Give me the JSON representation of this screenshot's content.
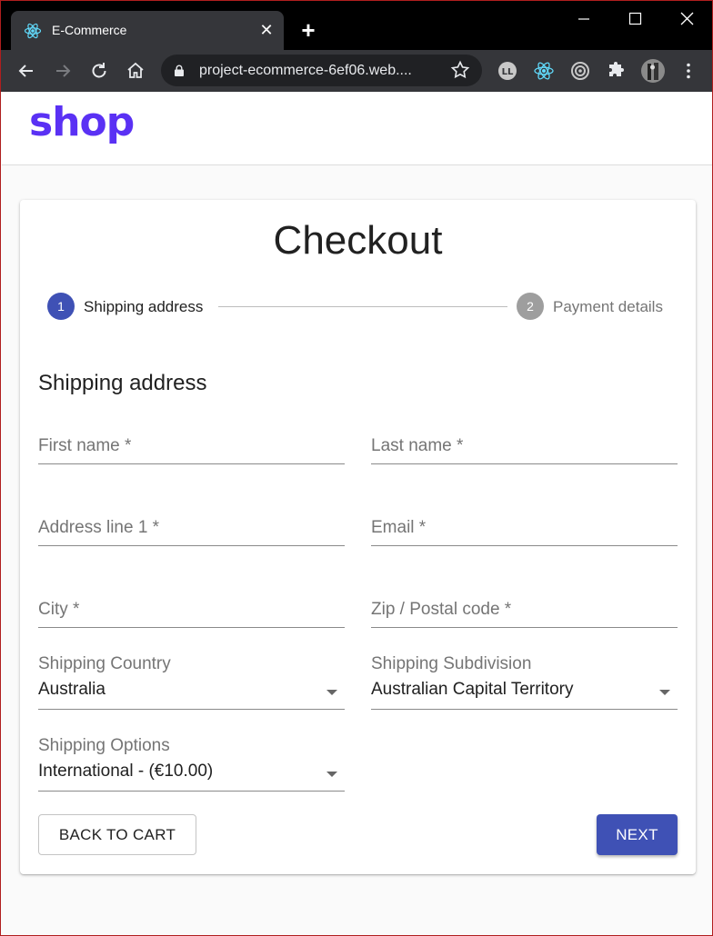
{
  "browser": {
    "tab_title": "E-Commerce",
    "url": "project-ecommerce-6ef06.web....",
    "tab_close_glyph": "✕",
    "new_tab_glyph": "+"
  },
  "app": {
    "logo": "shop",
    "logo_color": "#5a31f4"
  },
  "checkout": {
    "title": "Checkout",
    "steps": [
      {
        "number": "1",
        "label": "Shipping address",
        "active": true
      },
      {
        "number": "2",
        "label": "Payment details",
        "active": false
      }
    ],
    "section_title": "Shipping address",
    "fields": {
      "first_name": "First name *",
      "last_name": "Last name *",
      "address1": "Address line 1 *",
      "email": "Email *",
      "city": "City *",
      "zip": "Zip / Postal code *"
    },
    "selects": {
      "country": {
        "label": "Shipping Country",
        "value": "Australia"
      },
      "subdivision": {
        "label": "Shipping Subdivision",
        "value": "Australian Capital Territory"
      },
      "options": {
        "label": "Shipping Options",
        "value": "International - (€10.00)"
      }
    },
    "buttons": {
      "back": "BACK TO CART",
      "next": "NEXT"
    },
    "accent_color": "#3f51b5"
  }
}
